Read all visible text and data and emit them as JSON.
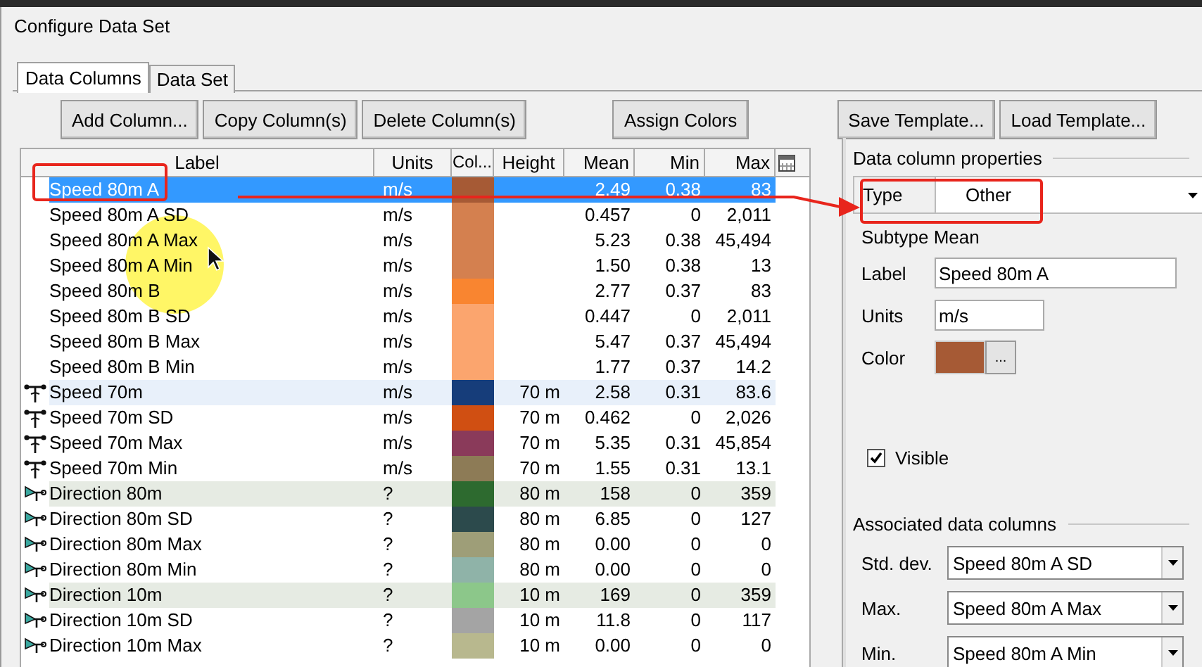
{
  "window": {
    "title": "Configure Data Set"
  },
  "tabs": [
    {
      "label": "Data Columns",
      "selected": true
    },
    {
      "label": "Data Set",
      "selected": false
    }
  ],
  "toolbar": {
    "left": [
      "Add Column...",
      "Copy Column(s)",
      "Delete Column(s)"
    ],
    "middle": [
      "Assign Colors"
    ],
    "right": [
      "Save Template...",
      "Load Template..."
    ]
  },
  "table": {
    "columns": [
      "Label",
      "Units",
      "Col...",
      "Height",
      "Mean",
      "Min",
      "Max"
    ],
    "rows": [
      {
        "kind": "plain",
        "label": "Speed 80m A",
        "units": "m/s",
        "color": "#a65a35",
        "height": "",
        "mean": "2.49",
        "min": "0.38",
        "max": "83",
        "selected": true,
        "primary": false
      },
      {
        "kind": "plain",
        "label": "Speed 80m A SD",
        "units": "m/s",
        "color": "#d4804f",
        "height": "",
        "mean": "0.457",
        "min": "0",
        "max": "2,011",
        "selected": false,
        "primary": false
      },
      {
        "kind": "plain",
        "label": "Speed 80m A Max",
        "units": "m/s",
        "color": "#d4804f",
        "height": "",
        "mean": "5.23",
        "min": "0.38",
        "max": "45,494",
        "selected": false,
        "primary": false
      },
      {
        "kind": "plain",
        "label": "Speed 80m A Min",
        "units": "m/s",
        "color": "#d4804f",
        "height": "",
        "mean": "1.50",
        "min": "0.38",
        "max": "13",
        "selected": false,
        "primary": false
      },
      {
        "kind": "plain",
        "label": "Speed 80m B",
        "units": "m/s",
        "color": "#f98530",
        "height": "",
        "mean": "2.77",
        "min": "0.37",
        "max": "83",
        "selected": false,
        "primary": false
      },
      {
        "kind": "plain",
        "label": "Speed 80m B SD",
        "units": "m/s",
        "color": "#fba56e",
        "height": "",
        "mean": "0.447",
        "min": "0",
        "max": "2,011",
        "selected": false,
        "primary": false
      },
      {
        "kind": "plain",
        "label": "Speed 80m B Max",
        "units": "m/s",
        "color": "#fba56e",
        "height": "",
        "mean": "5.47",
        "min": "0.37",
        "max": "45,494",
        "selected": false,
        "primary": false
      },
      {
        "kind": "plain",
        "label": "Speed 80m B Min",
        "units": "m/s",
        "color": "#fba56e",
        "height": "",
        "mean": "1.77",
        "min": "0.37",
        "max": "14.2",
        "selected": false,
        "primary": false
      },
      {
        "kind": "speed",
        "label": "Speed 70m",
        "units": "m/s",
        "color": "#163d7a",
        "height": "70 m",
        "mean": "2.58",
        "min": "0.31",
        "max": "83.6",
        "selected": false,
        "primary": true
      },
      {
        "kind": "speed",
        "label": "Speed 70m SD",
        "units": "m/s",
        "color": "#d04f12",
        "height": "70 m",
        "mean": "0.462",
        "min": "0",
        "max": "2,026",
        "selected": false,
        "primary": false
      },
      {
        "kind": "speed",
        "label": "Speed 70m Max",
        "units": "m/s",
        "color": "#8a3a5a",
        "height": "70 m",
        "mean": "5.35",
        "min": "0.31",
        "max": "45,854",
        "selected": false,
        "primary": false
      },
      {
        "kind": "speed",
        "label": "Speed 70m Min",
        "units": "m/s",
        "color": "#8d7b56",
        "height": "70 m",
        "mean": "1.55",
        "min": "0.31",
        "max": "13.1",
        "selected": false,
        "primary": false
      },
      {
        "kind": "direction",
        "label": "Direction 80m",
        "units": "?",
        "color": "#2d6a2f",
        "height": "80 m",
        "mean": "158",
        "min": "0",
        "max": "359",
        "selected": false,
        "primary": true
      },
      {
        "kind": "direction",
        "label": "Direction 80m SD",
        "units": "?",
        "color": "#2c4a4c",
        "height": "80 m",
        "mean": "6.85",
        "min": "0",
        "max": "127",
        "selected": false,
        "primary": false
      },
      {
        "kind": "direction",
        "label": "Direction 80m Max",
        "units": "?",
        "color": "#9e9e78",
        "height": "80 m",
        "mean": "0.00",
        "min": "0",
        "max": "0",
        "selected": false,
        "primary": false
      },
      {
        "kind": "direction",
        "label": "Direction 80m Min",
        "units": "?",
        "color": "#8fb3a8",
        "height": "80 m",
        "mean": "0.00",
        "min": "0",
        "max": "0",
        "selected": false,
        "primary": false
      },
      {
        "kind": "direction",
        "label": "Direction 10m",
        "units": "?",
        "color": "#8cc78a",
        "height": "10 m",
        "mean": "169",
        "min": "0",
        "max": "359",
        "selected": false,
        "primary": true
      },
      {
        "kind": "direction",
        "label": "Direction 10m SD",
        "units": "?",
        "color": "#a4a4a4",
        "height": "10 m",
        "mean": "11.8",
        "min": "0",
        "max": "117",
        "selected": false,
        "primary": false
      },
      {
        "kind": "direction",
        "label": "Direction 10m Max",
        "units": "?",
        "color": "#b8b88e",
        "height": "10 m",
        "mean": "0.00",
        "min": "0",
        "max": "0",
        "selected": false,
        "primary": false
      }
    ]
  },
  "properties": {
    "title": "Data column properties",
    "type_label": "Type",
    "type_value": "Other",
    "subtype": "Subtype Mean",
    "label_label": "Label",
    "label_value": "Speed 80m A",
    "units_label": "Units",
    "units_value": "m/s",
    "color_label": "Color",
    "color": "#a65a35",
    "color_button": "...",
    "visible_label": "Visible",
    "visible": true
  },
  "associated": {
    "title": "Associated data columns",
    "fields": [
      {
        "label": "Std. dev.",
        "value": "Speed 80m A SD"
      },
      {
        "label": "Max.",
        "value": "Speed 80m A Max"
      },
      {
        "label": "Min.",
        "value": "Speed 80m A Min"
      }
    ]
  }
}
